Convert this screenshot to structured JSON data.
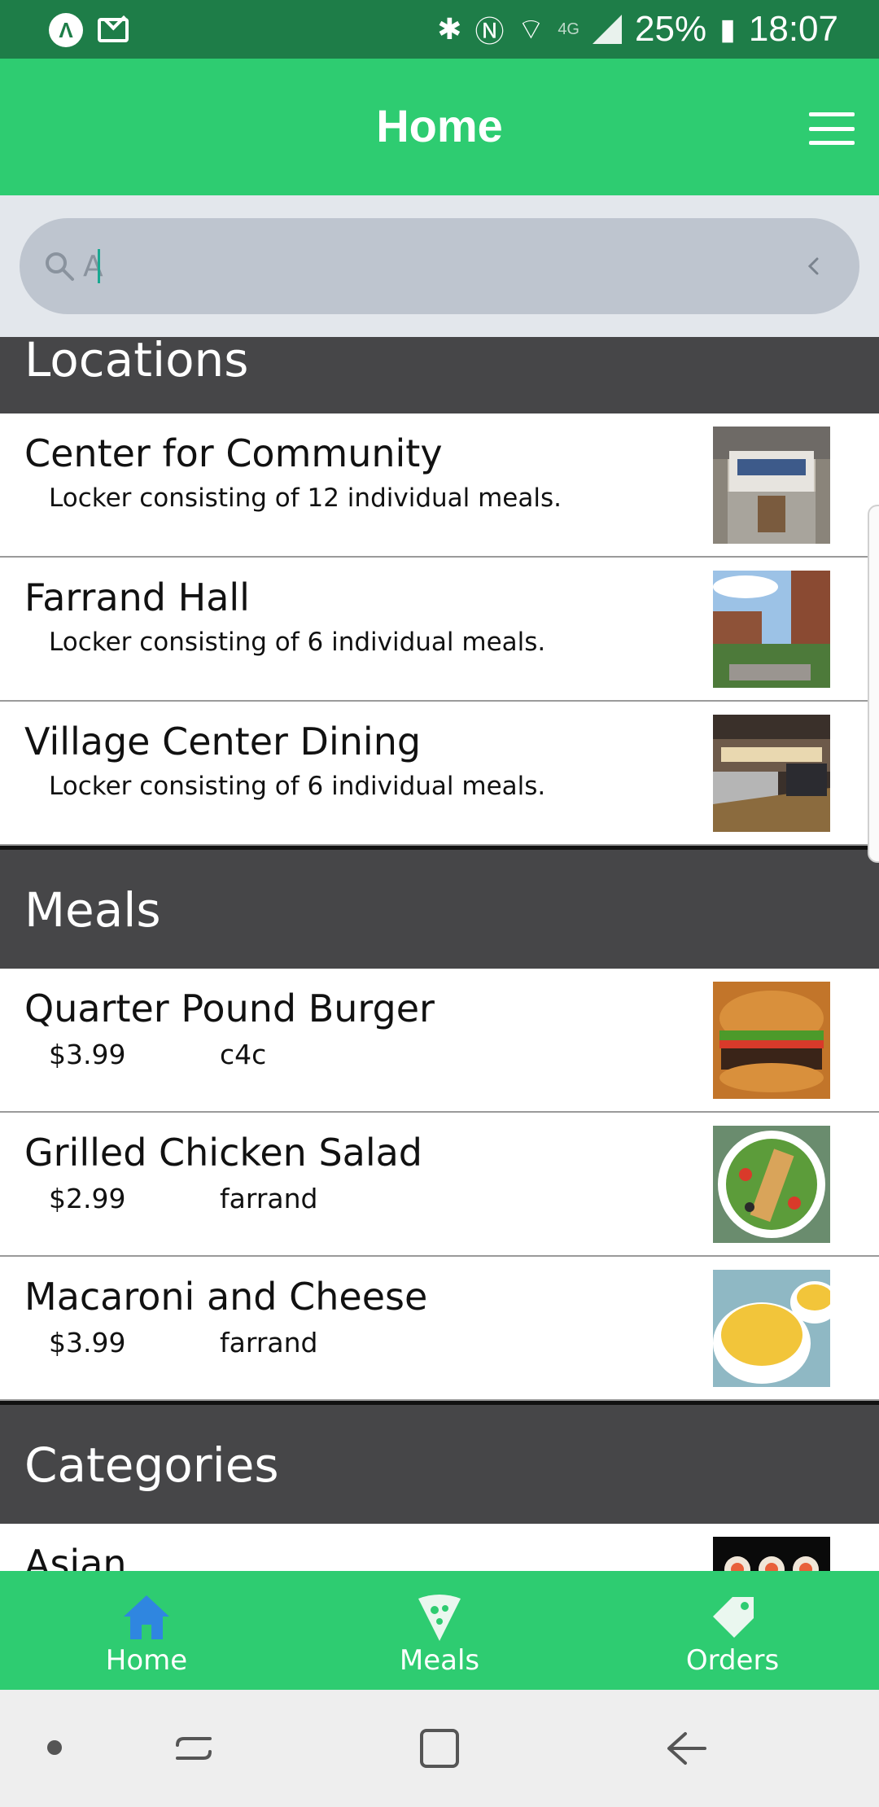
{
  "status_bar": {
    "notif_glyph": "Λ",
    "network": "4G",
    "battery": "25%",
    "time": "18:07"
  },
  "header": {
    "title": "Home"
  },
  "search": {
    "value": "A",
    "placeholder": ""
  },
  "sections": {
    "locations": {
      "title": "Locations",
      "items": [
        {
          "title": "Center for Community",
          "subtitle": "Locker consisting of 12 individual meals."
        },
        {
          "title": "Farrand Hall",
          "subtitle": "Locker consisting of 6 individual meals."
        },
        {
          "title": "Village Center Dining",
          "subtitle": "Locker consisting of 6 individual meals."
        }
      ]
    },
    "meals": {
      "title": "Meals",
      "items": [
        {
          "title": "Quarter Pound Burger",
          "price": "$3.99",
          "location": "c4c"
        },
        {
          "title": "Grilled Chicken Salad",
          "price": "$2.99",
          "location": "farrand"
        },
        {
          "title": "Macaroni and Cheese",
          "price": "$3.99",
          "location": "farrand"
        }
      ]
    },
    "categories": {
      "title": "Categories",
      "items": [
        {
          "title": "Asian"
        }
      ]
    }
  },
  "bottom_nav": {
    "items": [
      {
        "label": "Home",
        "icon": "home-icon",
        "active": true
      },
      {
        "label": "Meals",
        "icon": "pizza-icon",
        "active": false
      },
      {
        "label": "Orders",
        "icon": "tag-icon",
        "active": false
      }
    ]
  },
  "colors": {
    "status_bar": "#1e7d48",
    "header": "#2ecc71",
    "section_header": "#464648",
    "active_nav_icon": "#2f86e0",
    "search_bar": "#bec5cf"
  }
}
